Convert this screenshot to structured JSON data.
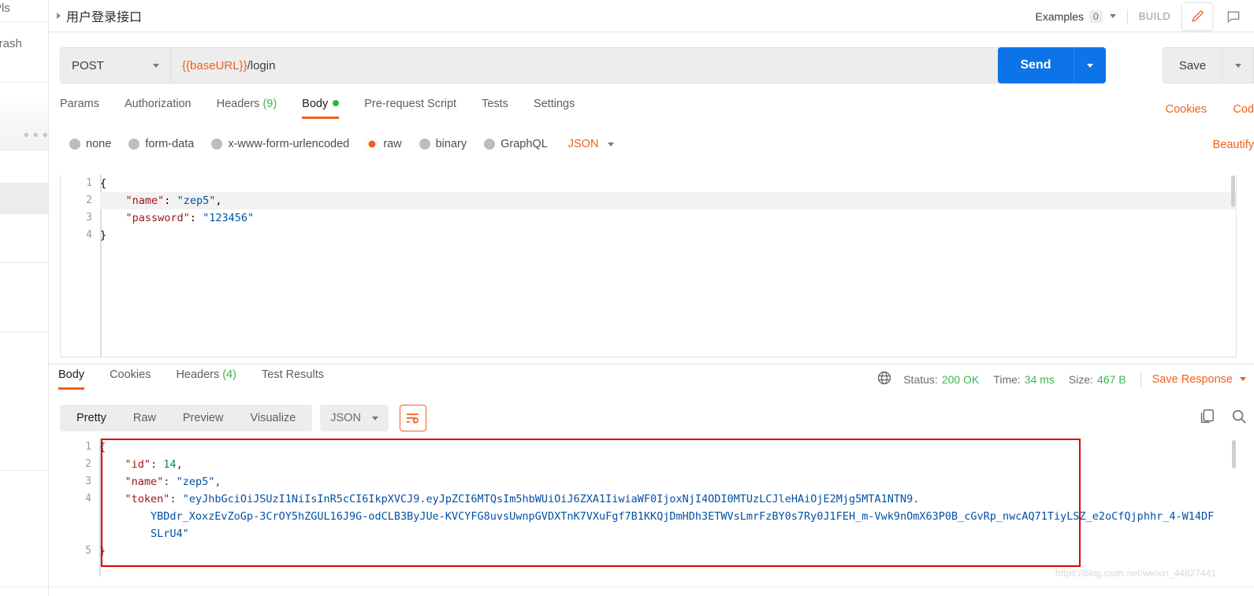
{
  "left_rail": {
    "apis_label": "Pls",
    "trash_label": "Trash",
    "dots_label": "⚬⚬⚬"
  },
  "topbar": {
    "request_title": "用户登录接口",
    "examples_label": "Examples",
    "examples_count": "0",
    "build_label": "BUILD",
    "edit_icon": "pencil-icon",
    "comment_icon": "comment-icon"
  },
  "url_row": {
    "method": "POST",
    "url_variable": "{{baseURL}}",
    "url_path": "/login",
    "send_label": "Send",
    "save_label": "Save"
  },
  "request_tabs": {
    "items": [
      {
        "label": "Params",
        "badge": "",
        "active": false
      },
      {
        "label": "Authorization",
        "badge": "",
        "active": false
      },
      {
        "label": "Headers",
        "badge": "(9)",
        "active": false
      },
      {
        "label": "Body",
        "badge": "",
        "active": true
      },
      {
        "label": "Pre-request Script",
        "badge": "",
        "active": false
      },
      {
        "label": "Tests",
        "badge": "",
        "active": false
      },
      {
        "label": "Settings",
        "badge": "",
        "active": false
      }
    ],
    "cookies_link": "Cookies",
    "code_link": "Cod"
  },
  "body_types": {
    "options": [
      {
        "label": "none",
        "selected": false
      },
      {
        "label": "form-data",
        "selected": false
      },
      {
        "label": "x-www-form-urlencoded",
        "selected": false
      },
      {
        "label": "raw",
        "selected": true
      },
      {
        "label": "binary",
        "selected": false
      },
      {
        "label": "GraphQL",
        "selected": false
      }
    ],
    "format": "JSON",
    "beautify_label": "Beautify"
  },
  "request_body": {
    "lines": [
      {
        "num": "1",
        "text": "{",
        "highlight": false
      },
      {
        "num": "2",
        "text": "    \"name\": \"zep5\",",
        "highlight": true
      },
      {
        "num": "3",
        "text": "    \"password\": \"123456\"",
        "highlight": false
      },
      {
        "num": "4",
        "text": "}",
        "highlight": false
      }
    ]
  },
  "response_tabs": {
    "items": [
      {
        "label": "Body",
        "badge": "",
        "active": true
      },
      {
        "label": "Cookies",
        "badge": "",
        "active": false
      },
      {
        "label": "Headers",
        "badge": "(4)",
        "active": false
      },
      {
        "label": "Test Results",
        "badge": "",
        "active": false
      }
    ]
  },
  "response_meta": {
    "globe_icon": "globe-icon",
    "status_key": "Status:",
    "status_value": "200 OK",
    "time_key": "Time:",
    "time_value": "34 ms",
    "size_key": "Size:",
    "size_value": "467 B",
    "save_response_label": "Save Response"
  },
  "response_toolbar": {
    "views": [
      {
        "label": "Pretty",
        "active": true
      },
      {
        "label": "Raw",
        "active": false
      },
      {
        "label": "Preview",
        "active": false
      },
      {
        "label": "Visualize",
        "active": false
      }
    ],
    "format": "JSON",
    "wrap_icon": "word-wrap-icon",
    "copy_icon": "copy-icon",
    "search_icon": "search-icon"
  },
  "response_body": {
    "lines": [
      {
        "num": "1",
        "segments": [
          {
            "t": "{",
            "c": "p"
          }
        ]
      },
      {
        "num": "2",
        "segments": [
          {
            "t": "    ",
            "c": "p"
          },
          {
            "t": "\"id\"",
            "c": "k"
          },
          {
            "t": ": ",
            "c": "p"
          },
          {
            "t": "14",
            "c": "n"
          },
          {
            "t": ",",
            "c": "p"
          }
        ]
      },
      {
        "num": "3",
        "segments": [
          {
            "t": "    ",
            "c": "p"
          },
          {
            "t": "\"name\"",
            "c": "k"
          },
          {
            "t": ": ",
            "c": "p"
          },
          {
            "t": "\"zep5\"",
            "c": "s"
          },
          {
            "t": ",",
            "c": "p"
          }
        ]
      },
      {
        "num": "4",
        "segments": [
          {
            "t": "    ",
            "c": "p"
          },
          {
            "t": "\"token\"",
            "c": "k"
          },
          {
            "t": ": ",
            "c": "p"
          },
          {
            "t": "\"eyJhbGciOiJSUzI1NiIsInR5cCI6IkpXVCJ9.eyJpZCI6MTQsIm5hbWUiOiJ6ZXA1IiwiaWF0IjoxNjI4ODI0MTUzLCJleHAiOjE2Mjg5MTA1NTN9.",
            "c": "s"
          }
        ]
      },
      {
        "num": "",
        "segments": [
          {
            "t": "        YBDdr_XoxzEvZoGp-3CrOY5hZGUL16J9G-odCLB3ByJUe-KVCYFG8uvsUwnpGVDXTnK7VXuFgf7B1KKQjDmHDh3ETWVsLmrFzBY0s7Ry0J1FEH_m-Vwk9nOmX63P0B_cGvRp_nwcAQ71TiyLSZ_e2oCfQjphhr_4-W14DF",
            "c": "s"
          }
        ]
      },
      {
        "num": "",
        "segments": [
          {
            "t": "        SLrU4\"",
            "c": "s"
          }
        ]
      },
      {
        "num": "5",
        "segments": [
          {
            "t": "}",
            "c": "p"
          }
        ]
      }
    ]
  },
  "watermark": "https://blog.csdn.net/weixin_44827441"
}
